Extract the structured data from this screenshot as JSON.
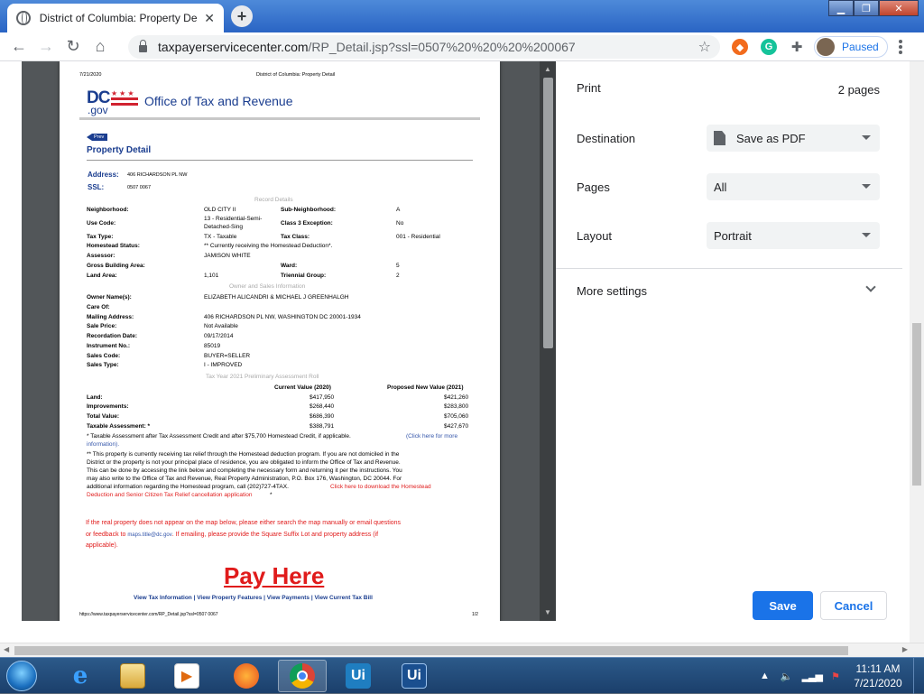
{
  "browser": {
    "tab_title": "District of Columbia: Property De",
    "url_host": "taxpayerservicecenter.com",
    "url_path": "/RP_Detail.jsp?ssl=0507%20%20%20%200067",
    "profile_label": "Paused"
  },
  "doc": {
    "header_date": "7/21/2020",
    "header_title": "District of Columbia: Property Detail",
    "logo_dc": "DC",
    "logo_gov": ".gov",
    "otr": "Office of Tax and Revenue",
    "prev": "Prev",
    "heading": "Property Detail",
    "address_label": "Address:",
    "address_value": "406 RICHARDSON PL NW",
    "ssl_label": "SSL:",
    "ssl_value": "0507 0067",
    "record_details": "Record Details",
    "r": {
      "neighborhood_l": "Neighborhood:",
      "neighborhood_v": "OLD CITY II",
      "subneigh_l": "Sub-Neighborhood:",
      "subneigh_v": "A",
      "usecode_l": "Use Code:",
      "usecode_v1": "13  -  Residential-Semi-",
      "usecode_v2": "Detached-Sing",
      "class3_l": "Class 3 Exception:",
      "class3_v": "No",
      "taxtype_l": "Tax Type:",
      "taxtype_v": "TX  - Taxable",
      "taxclass_l": "Tax Class:",
      "taxclass_v": "001 -  Residential",
      "homestead_l": "Homestead Status:",
      "homestead_v": "** Currently receiving the Homestead Deduction*.",
      "assessor_l": "Assessor:",
      "assessor_v": "JAMISON WHITE",
      "gba_l": "Gross Building Area:",
      "ward_l": "Ward:",
      "ward_v": "5",
      "landarea_l": "Land Area:",
      "landarea_v": "1,101",
      "triennial_l": "Triennial Group:",
      "triennial_v": "2"
    },
    "owner_section": "Owner and Sales Information",
    "o": {
      "owner_l": "Owner Name(s):",
      "owner_v": "ELIZABETH ALICANDRI & MICHAEL J GREENHALGH",
      "care_l": "Care Of:",
      "mail_l": "Mailing Address:",
      "mail_v": "406 RICHARDSON PL NW, WASHINGTON DC 20001-1934",
      "price_l": "Sale Price:",
      "price_v": "Not Available",
      "rec_l": "Recordation Date:",
      "rec_v": "09/17/2014",
      "inst_l": "Instrument No.:",
      "inst_v": "85019",
      "salescode_l": "Sales Code:",
      "salescode_v": "BUYER=SELLER",
      "salestype_l": "Sales Type:",
      "salestype_v": "I - IMPROVED"
    },
    "assess_section": "Tax Year 2021 Preliminary Assessment Roll",
    "a": {
      "col1": "Current Value (2020)",
      "col2": "Proposed New Value (2021)",
      "rows": [
        {
          "label": "Land:",
          "cur": "$417,950",
          "new": "$421,260"
        },
        {
          "label": "Improvements:",
          "cur": "$268,440",
          "new": "$283,800"
        },
        {
          "label": "Total Value:",
          "cur": "$686,390",
          "new": "$705,060"
        },
        {
          "label": "Taxable Assessment: *",
          "cur": "$388,791",
          "new": "$427,670"
        }
      ],
      "note1": "* Taxable Assessment after Tax Assessment Credit and after $75,700 Homestead Credit, if applicable.",
      "note1_link": "(Click here for more",
      "note1_link2": "information).",
      "note2_l1": "** This property is currently receiving tax relief through the Homestead deduction program. If you are not domiciled in the",
      "note2_l2": "District or the property is not your principal place of residence, you are obligated to inform the Office of Tax and Revenue.",
      "note2_l3": "This can be done by accessing the link below and completing the necessary form and returning it per the instructions. You",
      "note2_l4": "may also write to the Office of Tax and Revenue, Real Property Administration, P.O. Box 176, Washington, DC 20044. For",
      "note2_l5": "additional information regarding the Homestead program, call (202)727-4TAX.",
      "note2_link": "Click here to download the Homestead",
      "note2_link2": "Deduction and Senior Citizen Tax Relief cancellation application",
      "note2_star": " *"
    },
    "map_l1": "If the real property does not appear on the map below, please either search the map manually or email questions",
    "map_l2a": "or feedback to ",
    "map_email": "maps.title@dc.gov",
    "map_l2b": ". If emailing, please provide the Square Suffix Lot and property address (if",
    "map_l3": "applicable).",
    "pay_here": "Pay Here",
    "links": [
      "View Tax Information",
      "View Property Features",
      "View Payments",
      "View Current Tax Bill"
    ],
    "footer_url": "https://www.taxpayerservicecenter.com/RP_Detail.jsp?ssl=0507 0067",
    "footer_page": "1/2"
  },
  "print": {
    "title": "Print",
    "pages_count": "2 pages",
    "destination_label": "Destination",
    "destination_value": "Save as PDF",
    "pages_label": "Pages",
    "pages_value": "All",
    "layout_label": "Layout",
    "layout_value": "Portrait",
    "more_settings": "More settings",
    "save": "Save",
    "cancel": "Cancel"
  },
  "taskbar": {
    "time": "11:11 AM",
    "date": "7/21/2020",
    "ui1": "Ui",
    "ui2": "Ui"
  },
  "colors": {
    "accent": "#1a73e8",
    "dc_red": "#d1222f",
    "dc_blue": "#1a3d8f",
    "link_red": "#e01b1b"
  }
}
